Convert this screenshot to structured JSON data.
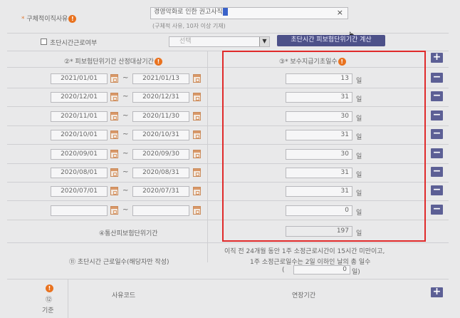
{
  "reason": {
    "label": "구체적이직사유",
    "value": "경영악화로 인한 권고사직",
    "hint": "(구체적 사유, 10자 이상 기재)",
    "clear_glyph": "×"
  },
  "short_time": {
    "checkbox_label": "초단시간근로여부",
    "select_value": "선택",
    "calc_button": "초단시간 피보험단위기간 계산"
  },
  "headers": {
    "period": "②* 피보험단위기간 산정대상기간",
    "days": "③* 보수지급기초일수"
  },
  "day_unit": "일",
  "tilde": "~",
  "rows": [
    {
      "start": "2021/01/01",
      "end": "2021/01/13",
      "days": "13"
    },
    {
      "start": "2020/12/01",
      "end": "2020/12/31",
      "days": "31"
    },
    {
      "start": "2020/11/01",
      "end": "2020/11/30",
      "days": "30"
    },
    {
      "start": "2020/10/01",
      "end": "2020/10/31",
      "days": "31"
    },
    {
      "start": "2020/09/01",
      "end": "2020/09/30",
      "days": "30"
    },
    {
      "start": "2020/08/01",
      "end": "2020/08/31",
      "days": "31"
    },
    {
      "start": "2020/07/01",
      "end": "2020/07/31",
      "days": "31"
    },
    {
      "start": "",
      "end": "",
      "days": "0"
    }
  ],
  "total": {
    "label": "④통산피보험단위기간",
    "value": "197"
  },
  "short_days": {
    "label": "⑪ 초단시간 근로일수(해당자만 작성)",
    "desc1": "이직 전 24개월 동안 1주 소정근로시간이 15시간 미만이고,",
    "desc2": "1주 소정근로일수는 2일 이하인 날의 총 일수",
    "paren_open": "(",
    "paren_close": "일)",
    "value": "0"
  },
  "bottom": {
    "side_label": "기준",
    "side_num": "⑫",
    "col1": "사유코드",
    "col2": "연장기간"
  },
  "plus": "+",
  "minus": "−",
  "colors": {
    "highlight_border": "#e02a2a",
    "button": "#5c5f95",
    "accent": "#e9721f"
  }
}
